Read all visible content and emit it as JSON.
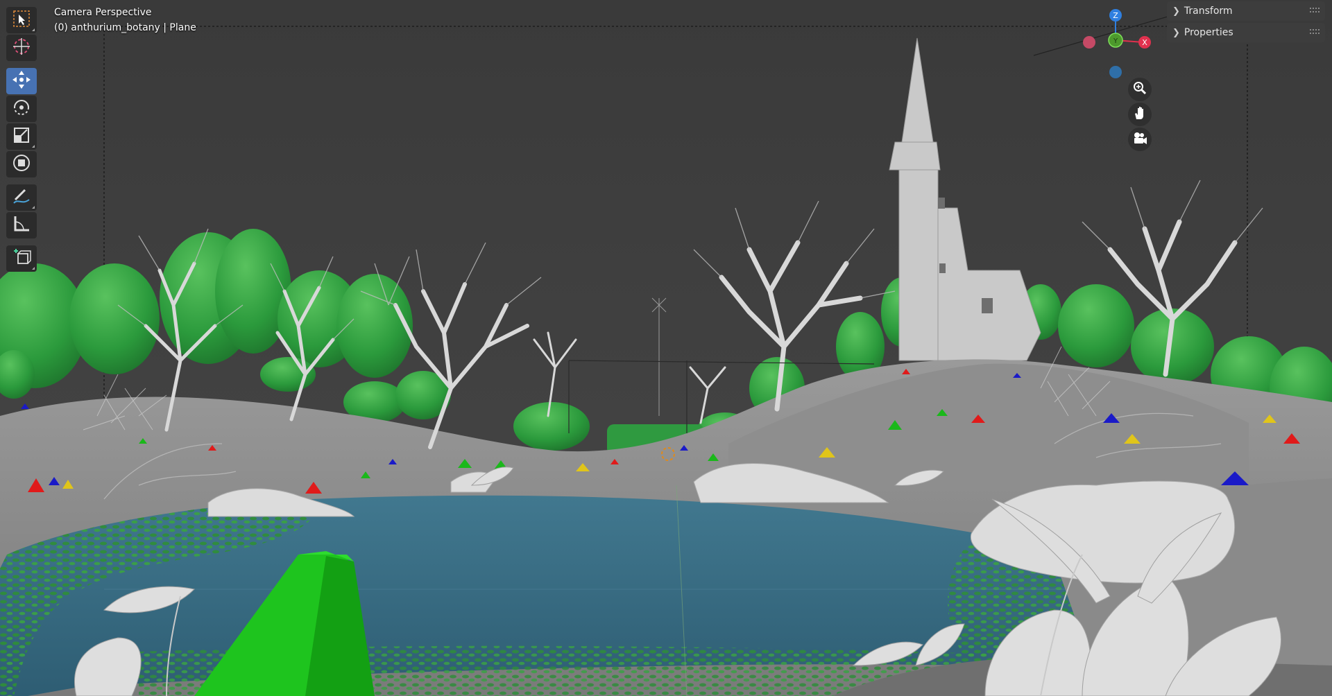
{
  "viewport": {
    "camera_label": "Camera Perspective",
    "object_label": "(0) anthurium_botany | Plane"
  },
  "toolbar": {
    "tools": [
      {
        "name": "select-box",
        "icon": "select-arrow-icon",
        "active": false
      },
      {
        "name": "cursor",
        "icon": "cursor-icon",
        "active": false
      },
      {
        "name": "move",
        "icon": "move-icon",
        "active": true
      },
      {
        "name": "rotate",
        "icon": "rotate-icon",
        "active": false
      },
      {
        "name": "scale",
        "icon": "scale-icon",
        "active": false
      },
      {
        "name": "transform",
        "icon": "transform-icon",
        "active": false
      },
      {
        "name": "annotate",
        "icon": "annotate-icon",
        "active": false
      },
      {
        "name": "measure",
        "icon": "measure-icon",
        "active": false
      },
      {
        "name": "add-cube",
        "icon": "add-cube-icon",
        "active": false
      }
    ]
  },
  "gizmo": {
    "z_label": "Z",
    "x_label": "X",
    "y_label": "Y",
    "colors": {
      "x": "#e0314e",
      "y": "#6bb32f",
      "z": "#2f7fe0"
    }
  },
  "nav_buttons": [
    "zoom-icon",
    "hand-icon",
    "camera-icon"
  ],
  "sidebar": {
    "panels": [
      {
        "label": "Transform"
      },
      {
        "label": "Properties"
      }
    ]
  },
  "colors": {
    "active_tool": "#4772b3",
    "water": "#3f7793",
    "foliage": "#2fa544",
    "terrain": "#8b8b8b"
  }
}
